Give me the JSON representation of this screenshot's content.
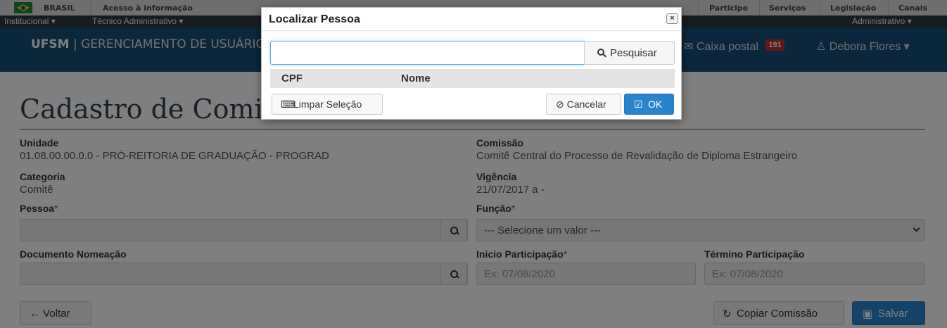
{
  "govbar": {
    "country": "BRASIL",
    "access_info": "Acesso à informação",
    "links": [
      "Participe",
      "Serviços",
      "Legislação",
      "Canais"
    ]
  },
  "menubar": {
    "institucional": "Institucional ▾",
    "tecnico": "Técnico Administrativo ▾",
    "administrativo": "Administrativo ▾"
  },
  "header": {
    "brand_bold": "UFSM",
    "brand_rest": " | GERENCIAMENTO DE USUÁRIO",
    "mail_label": "Caixa postal",
    "mail_count": "191",
    "user_name": "Debora Flores ▾"
  },
  "page": {
    "title": "Cadastro de Comissões",
    "unidade_label": "Unidade",
    "unidade_value": "01.08.00.00.0.0 - PRÓ-REITORIA DE GRADUAÇÃO - PROGRAD",
    "categoria_label": "Categoria",
    "categoria_value": "Comitê",
    "pessoa_label": "Pessoa",
    "documento_label": "Documento Nomeação",
    "comissao_label": "Comissão",
    "comissao_value": "Comitê Central do Processo de Revalidação de Diploma Estrangeiro",
    "vigencia_label": "Vigência",
    "vigencia_value": "21/07/2017 a -",
    "funcao_label": "Função",
    "funcao_selected": "--- Selecione um valor ---",
    "inicio_label": "Inicio Participação",
    "inicio_placeholder": "Ex: 07/08/2020",
    "termino_label": "Término Participação",
    "termino_placeholder": "Ex: 07/08/2020",
    "required_mark": "*",
    "voltar_label": "← Voltar",
    "copiar_label": "Copiar Comissão",
    "salvar_label": "Salvar"
  },
  "modal": {
    "title": "Localizar Pessoa",
    "close": "×",
    "search_value": "",
    "search_label": "Pesquisar",
    "col_cpf": "CPF",
    "col_nome": "Nome",
    "limpar_label": "Limpar Seleção",
    "cancelar_label": "⊘ Cancelar",
    "ok_label": "OK"
  },
  "colors": {
    "header_blue": "#154f78",
    "primary": "#2a84cd",
    "required": "#c9302c"
  }
}
